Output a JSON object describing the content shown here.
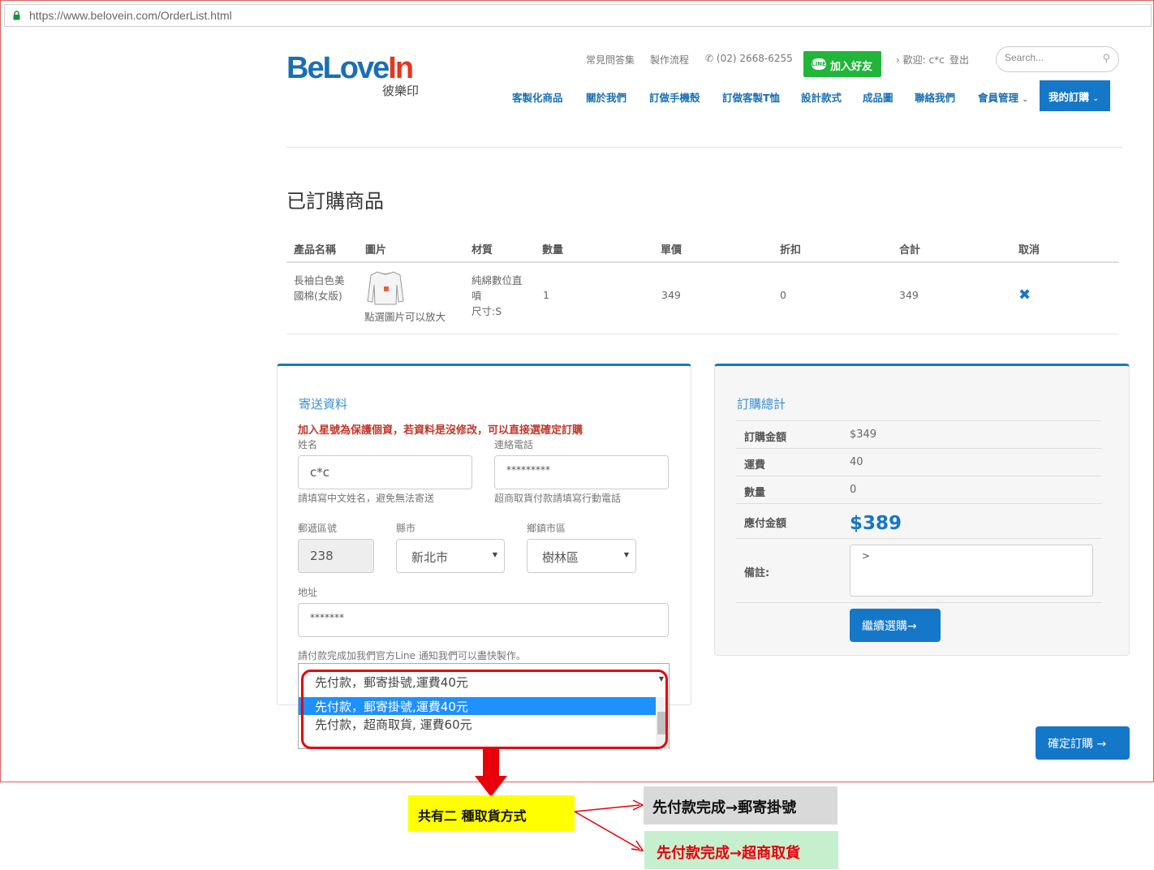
{
  "browser": {
    "url": "https://www.belovein.com/OrderList.html"
  },
  "brand": {
    "logo_main_1": "BeLove",
    "logo_main_2": "In",
    "logo_sub": "彼樂印",
    "primary_color": "#1577c8",
    "logo_red": "#e8351e"
  },
  "topbar": {
    "faq": "常見問答集",
    "process": "製作流程",
    "phone": "(02) 2668-6255",
    "line_button": "加入好友",
    "line_icon_text": "LINE",
    "welcome": "歡迎: c*c",
    "logout": "登出",
    "search_placeholder": "Search..."
  },
  "nav": {
    "items": [
      "客製化商品",
      "關於我們",
      "訂做手機殼",
      "訂做客製T恤",
      "設計款式",
      "成品圖",
      "聯絡我們",
      "會員管理"
    ],
    "my_orders": "我的訂購"
  },
  "page_title": "已訂購商品",
  "table": {
    "headers": [
      "產品名稱",
      "圖片",
      "材質",
      "數量",
      "單價",
      "折扣",
      "合計",
      "取消"
    ],
    "rows": [
      {
        "name_line1": "長袖白色美",
        "name_line2": "國棉(女版)",
        "image_caption": "點選圖片可以放大",
        "material_line1": "純綿數位直",
        "material_line2": "噴",
        "material_line3": "尺寸:S",
        "qty": "1",
        "price": "349",
        "discount": "0",
        "total": "349",
        "cancel_icon": "cross-icon"
      }
    ]
  },
  "shipping": {
    "title": "寄送資料",
    "notice": "加入星號為保護個資，若資料是沒修改，可以直接選確定訂購",
    "name_label": "姓名",
    "name_value": "c*c",
    "name_hint": "請填寫中文姓名，避免無法寄送",
    "phone_label": "連絡電話",
    "phone_value": "*********",
    "phone_hint": "超商取貨付款請填寫行動電話",
    "zip_label": "郵遞區號",
    "zip_value": "238",
    "city_label": "縣市",
    "city_value": "新北市",
    "district_label": "鄉鎮市區",
    "district_value": "樹林區",
    "address_label": "地址",
    "address_value": "*******",
    "line_note": "請付款完成加我們官方Line 通知我們可以盡快製作。",
    "payment_selected": "先付款，郵寄掛號,運費40元",
    "payment_options": [
      "先付款，郵寄掛號,運費40元",
      "先付款，超商取貨, 運費60元"
    ]
  },
  "summary": {
    "title": "訂購總計",
    "amount_label": "訂購金額",
    "amount_value": "$349",
    "shipping_label": "運費",
    "shipping_value": "40",
    "qty_label": "數量",
    "qty_value": "0",
    "payable_label": "應付金額",
    "payable_value": "$389",
    "memo_label": "備註:",
    "memo_value": ">",
    "continue_button": "繼續選購→"
  },
  "confirm_button": "確定訂購 →",
  "annotation": {
    "main": "共有二 種取貨方式",
    "option_post": "先付款完成→郵寄掛號",
    "option_store": "先付款完成→超商取貨",
    "highlight_color": "#e8000b"
  }
}
